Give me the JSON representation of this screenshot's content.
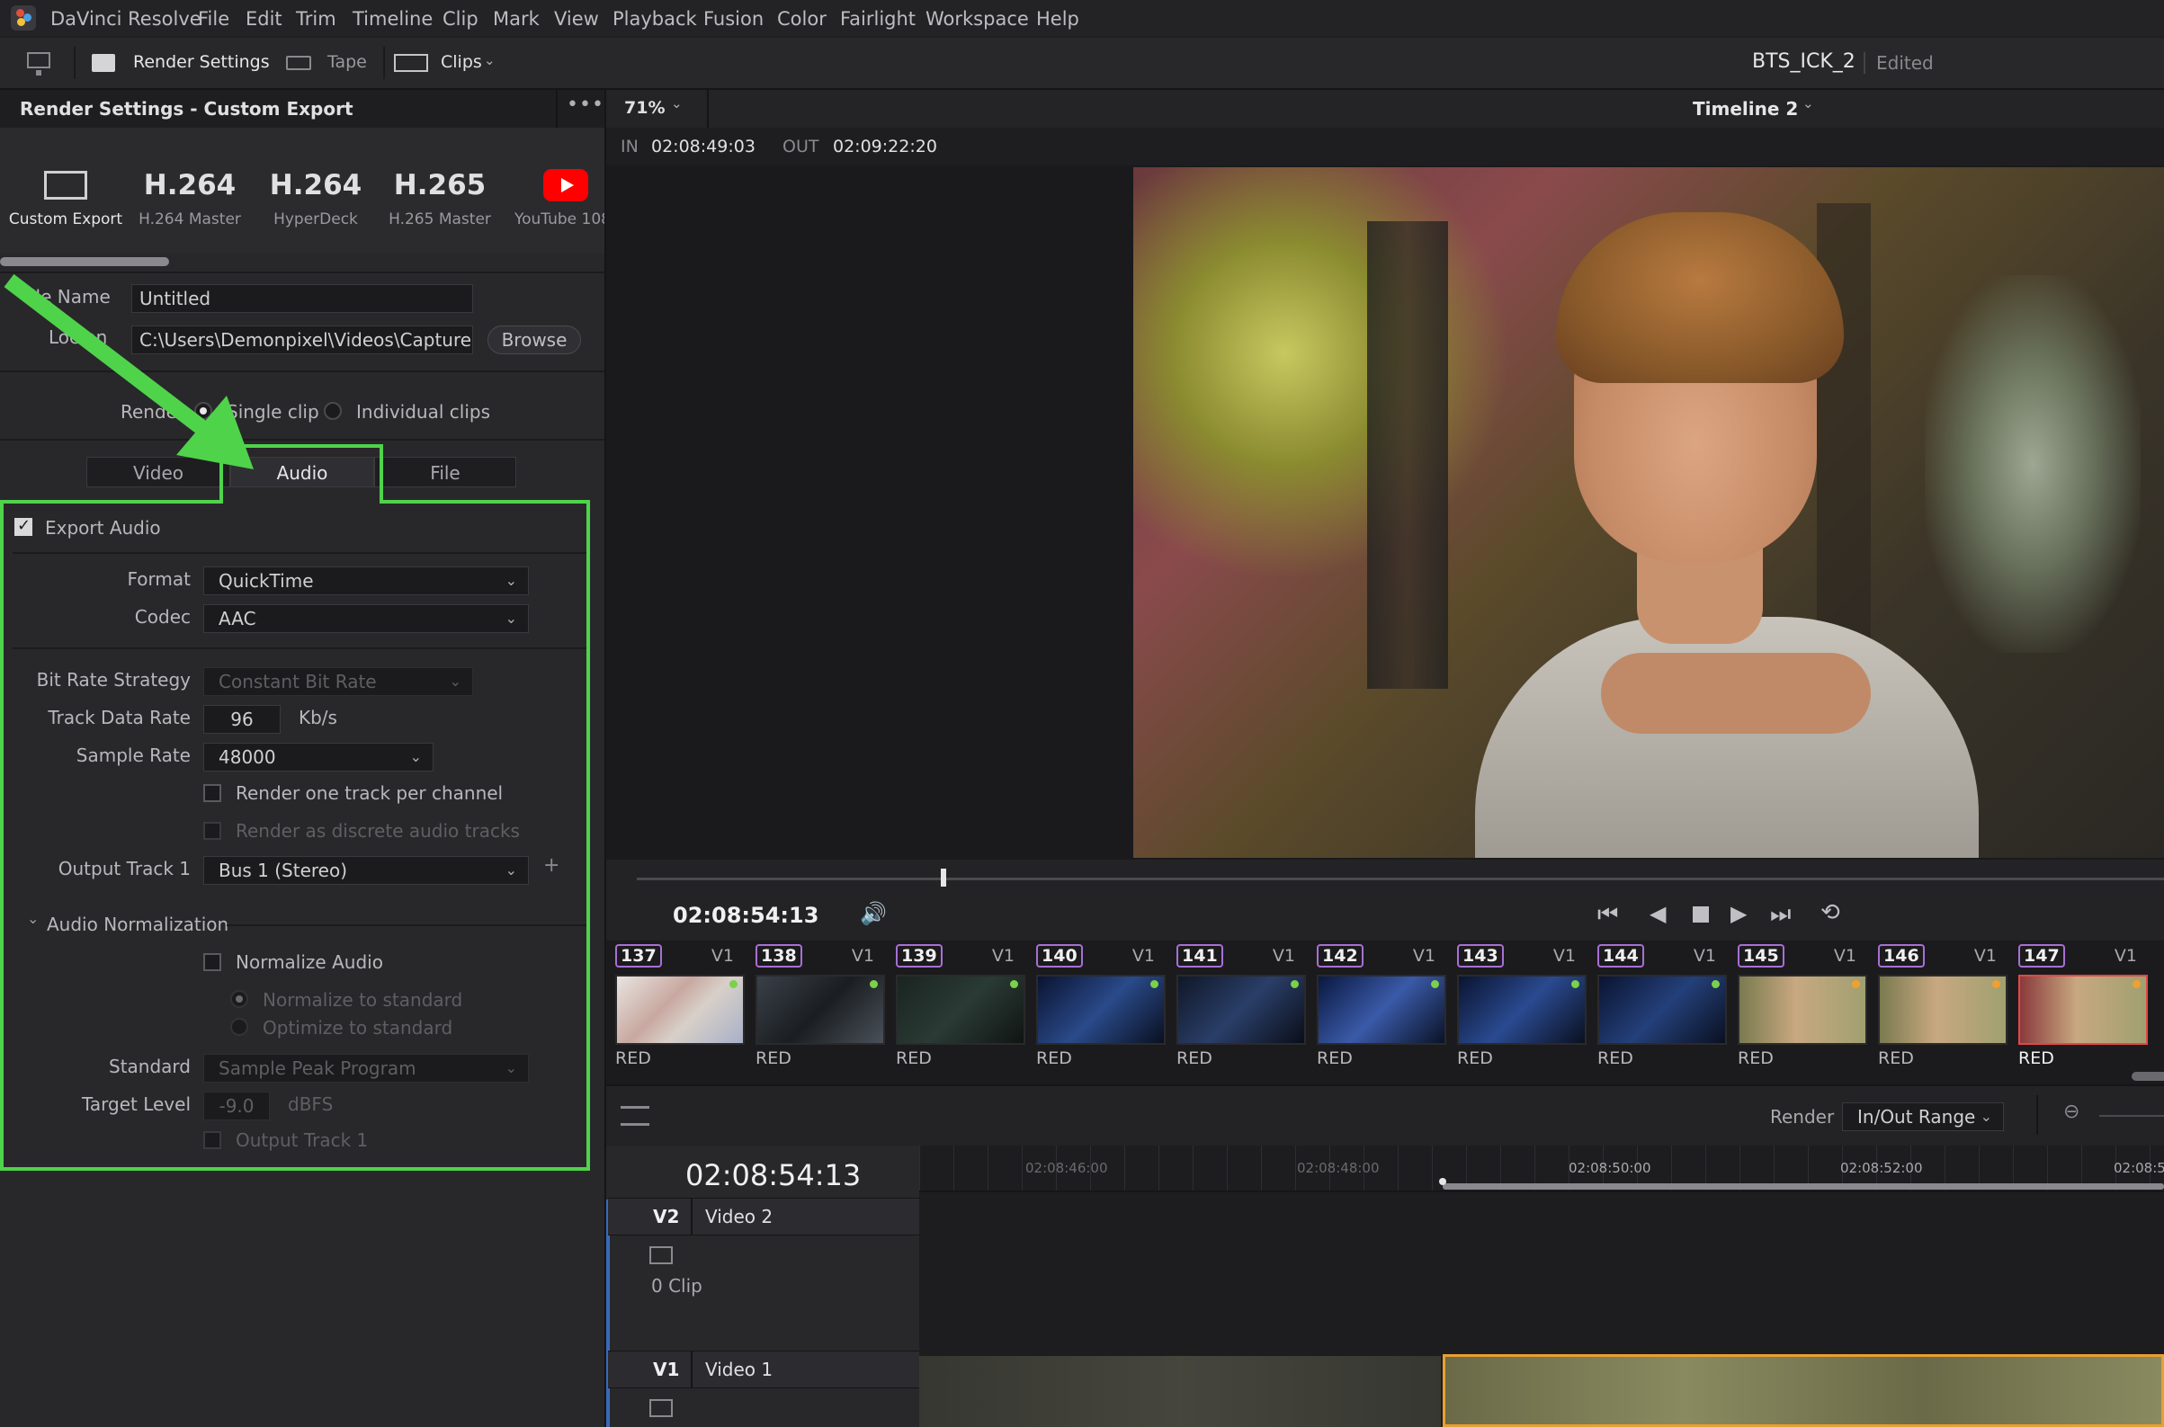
{
  "menu": [
    "DaVinci Resolve",
    "File",
    "Edit",
    "Trim",
    "Timeline",
    "Clip",
    "Mark",
    "View",
    "Playback",
    "Fusion",
    "Color",
    "Fairlight",
    "Workspace",
    "Help"
  ],
  "toolbar": {
    "render_settings": "Render Settings",
    "tape": "Tape",
    "clips": "Clips",
    "project_name": "BTS_ICK_2",
    "project_status": "Edited"
  },
  "panel": {
    "title": "Render Settings - Custom Export",
    "presets": [
      {
        "big": "",
        "label": "Custom Export"
      },
      {
        "big": "H.264",
        "label": "H.264 Master"
      },
      {
        "big": "H.264",
        "label": "HyperDeck"
      },
      {
        "big": "H.265",
        "label": "H.265 Master"
      },
      {
        "big": "",
        "label": "YouTube 108"
      }
    ],
    "file_name_label": "ile Name",
    "file_name": "Untitled",
    "location_label": "Loc     on",
    "location": "C:\\Users\\Demonpixel\\Videos\\Captures",
    "browse": "Browse",
    "render_label": "Rende",
    "single_clip": "Single clip",
    "individual_clips": "Individual clips",
    "tabs": {
      "video": "Video",
      "audio": "Audio",
      "file": "File"
    }
  },
  "audio": {
    "export_audio": "Export Audio",
    "format_label": "Format",
    "format": "QuickTime",
    "codec_label": "Codec",
    "codec": "AAC",
    "bitrate_strategy_label": "Bit Rate Strategy",
    "bitrate_strategy": "Constant Bit Rate",
    "track_data_rate_label": "Track Data Rate",
    "track_data_rate": "96",
    "track_data_rate_unit": "Kb/s",
    "sample_rate_label": "Sample Rate",
    "sample_rate": "48000",
    "one_track_per_channel": "Render one track per channel",
    "discrete_tracks": "Render as discrete audio tracks",
    "output_track_label": "Output Track 1",
    "output_track": "Bus 1 (Stereo)",
    "normalization_header": "Audio Normalization",
    "normalize_audio": "Normalize Audio",
    "normalize_to_standard": "Normalize to standard",
    "optimize_to_standard": "Optimize to standard",
    "standard_label": "Standard",
    "standard": "Sample Peak Program",
    "target_level_label": "Target Level",
    "target_level": "-9.0",
    "target_level_unit": "dBFS",
    "output_track_check": "Output Track 1"
  },
  "viewer": {
    "zoom": "71%",
    "timeline_name": "Timeline 2",
    "in_label": "IN",
    "in_tc": "02:08:49:03",
    "out_label": "OUT",
    "out_tc": "02:09:22:20",
    "current_tc": "02:08:54:13"
  },
  "clips": [
    {
      "num": "137",
      "track": "V1",
      "codec": "RED",
      "dot": "#7bd14a"
    },
    {
      "num": "138",
      "track": "V1",
      "codec": "RED",
      "dot": "#7bd14a"
    },
    {
      "num": "139",
      "track": "V1",
      "codec": "RED",
      "dot": "#7bd14a"
    },
    {
      "num": "140",
      "track": "V1",
      "codec": "RED",
      "dot": "#7bd14a"
    },
    {
      "num": "141",
      "track": "V1",
      "codec": "RED",
      "dot": "#7bd14a"
    },
    {
      "num": "142",
      "track": "V1",
      "codec": "RED",
      "dot": "#7bd14a"
    },
    {
      "num": "143",
      "track": "V1",
      "codec": "RED",
      "dot": "#7bd14a"
    },
    {
      "num": "144",
      "track": "V1",
      "codec": "RED",
      "dot": "#7bd14a"
    },
    {
      "num": "145",
      "track": "V1",
      "codec": "RED",
      "dot": "#f0a030"
    },
    {
      "num": "146",
      "track": "V1",
      "codec": "RED",
      "dot": "#f0a030"
    },
    {
      "num": "147",
      "track": "V1",
      "codec": "RED",
      "dot": "#f0a030"
    }
  ],
  "render_row": {
    "label": "Render",
    "range": "In/Out Range"
  },
  "timeline": {
    "tc": "02:08:54:13",
    "ruler": [
      "02:08:46:00",
      "02:08:48:00",
      "02:08:50:00",
      "02:08:52:00",
      "02:08:5"
    ],
    "v2_label": "V2",
    "v2_name": "Video 2",
    "v2_clips": "0 Clip",
    "v1_label": "V1",
    "v1_name": "Video 1"
  },
  "colors": {
    "highlight": "#4fd34a",
    "accent_red": "#e04848"
  }
}
